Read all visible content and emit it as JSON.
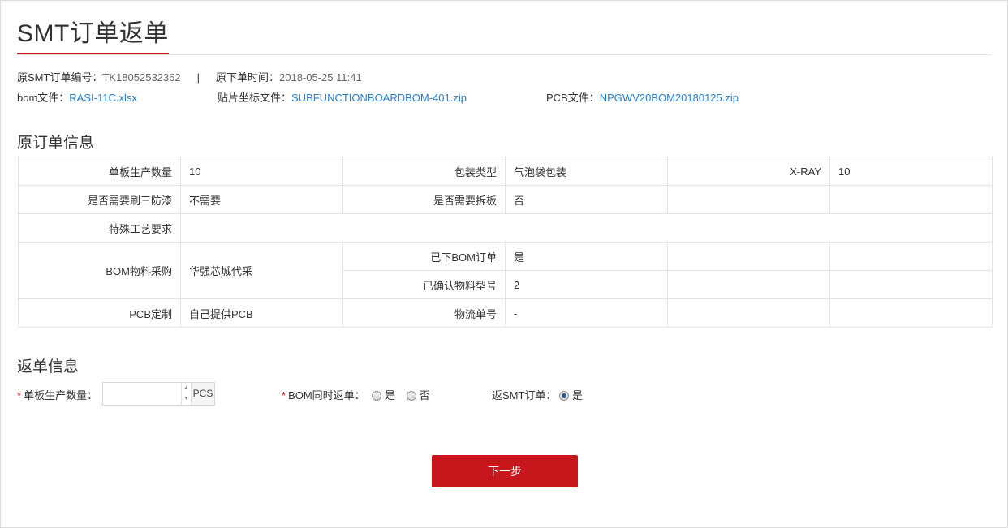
{
  "page": {
    "title": "SMT订单返单"
  },
  "meta": {
    "order_no_label": "原SMT订单编号：",
    "order_no": "TK18052532362",
    "separator": "|",
    "order_time_label": "原下单时间：",
    "order_time": "2018-05-25 11:41",
    "bom_label": "bom文件：",
    "bom_file": "RASI-11C.xlsx",
    "coord_label": "贴片坐标文件：",
    "coord_file": "SUBFUNCTIONBOARDBOM-401.zip",
    "pcb_label": "PCB文件：",
    "pcb_file": "NPGWV20BOM20180125.zip"
  },
  "original_section": {
    "heading": "原订单信息",
    "rows": {
      "qty_label": "单板生产数量",
      "qty": "10",
      "pack_label": "包装类型",
      "pack": "气泡袋包装",
      "xray_label": "X-RAY",
      "xray": "10",
      "coating_label": "是否需要刷三防漆",
      "coating": "不需要",
      "split_label": "是否需要拆板",
      "split": "否",
      "special_label": "特殊工艺要求",
      "special": "",
      "bom_purchase_label": "BOM物料采购",
      "bom_purchase": "华强芯城代采",
      "bom_ordered_label": "已下BOM订单",
      "bom_ordered": "是",
      "confirmed_label": "已确认物料型号",
      "confirmed": "2",
      "pcb_custom_label": "PCB定制",
      "pcb_custom": "自己提供PCB",
      "tracking_label": "物流单号",
      "tracking": "-"
    }
  },
  "return_section": {
    "heading": "返单信息",
    "required_mark": "*",
    "qty_label": "单板生产数量：",
    "qty_value": "",
    "qty_unit": "PCS",
    "bom_return_label": "BOM同时返单：",
    "bom_options": [
      "是",
      "否"
    ],
    "bom_selected": null,
    "smt_return_label": "返SMT订单：",
    "smt_options": [
      "是"
    ],
    "smt_selected": "是"
  },
  "actions": {
    "next_label": "下一步"
  },
  "colors": {
    "accent": "#c8161d",
    "link": "#2a7fc9",
    "border": "#e3e3e3"
  }
}
